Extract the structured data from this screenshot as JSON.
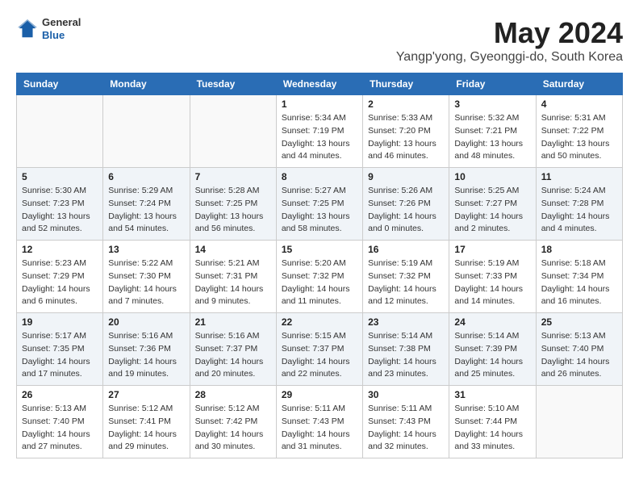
{
  "header": {
    "logo": {
      "general": "General",
      "blue": "Blue"
    },
    "month_year": "May 2024",
    "location": "Yangp'yong, Gyeonggi-do, South Korea"
  },
  "weekdays": [
    "Sunday",
    "Monday",
    "Tuesday",
    "Wednesday",
    "Thursday",
    "Friday",
    "Saturday"
  ],
  "weeks": [
    [
      {
        "day": "",
        "info": ""
      },
      {
        "day": "",
        "info": ""
      },
      {
        "day": "",
        "info": ""
      },
      {
        "day": "1",
        "info": "Sunrise: 5:34 AM\nSunset: 7:19 PM\nDaylight: 13 hours\nand 44 minutes."
      },
      {
        "day": "2",
        "info": "Sunrise: 5:33 AM\nSunset: 7:20 PM\nDaylight: 13 hours\nand 46 minutes."
      },
      {
        "day": "3",
        "info": "Sunrise: 5:32 AM\nSunset: 7:21 PM\nDaylight: 13 hours\nand 48 minutes."
      },
      {
        "day": "4",
        "info": "Sunrise: 5:31 AM\nSunset: 7:22 PM\nDaylight: 13 hours\nand 50 minutes."
      }
    ],
    [
      {
        "day": "5",
        "info": "Sunrise: 5:30 AM\nSunset: 7:23 PM\nDaylight: 13 hours\nand 52 minutes."
      },
      {
        "day": "6",
        "info": "Sunrise: 5:29 AM\nSunset: 7:24 PM\nDaylight: 13 hours\nand 54 minutes."
      },
      {
        "day": "7",
        "info": "Sunrise: 5:28 AM\nSunset: 7:25 PM\nDaylight: 13 hours\nand 56 minutes."
      },
      {
        "day": "8",
        "info": "Sunrise: 5:27 AM\nSunset: 7:25 PM\nDaylight: 13 hours\nand 58 minutes."
      },
      {
        "day": "9",
        "info": "Sunrise: 5:26 AM\nSunset: 7:26 PM\nDaylight: 14 hours\nand 0 minutes."
      },
      {
        "day": "10",
        "info": "Sunrise: 5:25 AM\nSunset: 7:27 PM\nDaylight: 14 hours\nand 2 minutes."
      },
      {
        "day": "11",
        "info": "Sunrise: 5:24 AM\nSunset: 7:28 PM\nDaylight: 14 hours\nand 4 minutes."
      }
    ],
    [
      {
        "day": "12",
        "info": "Sunrise: 5:23 AM\nSunset: 7:29 PM\nDaylight: 14 hours\nand 6 minutes."
      },
      {
        "day": "13",
        "info": "Sunrise: 5:22 AM\nSunset: 7:30 PM\nDaylight: 14 hours\nand 7 minutes."
      },
      {
        "day": "14",
        "info": "Sunrise: 5:21 AM\nSunset: 7:31 PM\nDaylight: 14 hours\nand 9 minutes."
      },
      {
        "day": "15",
        "info": "Sunrise: 5:20 AM\nSunset: 7:32 PM\nDaylight: 14 hours\nand 11 minutes."
      },
      {
        "day": "16",
        "info": "Sunrise: 5:19 AM\nSunset: 7:32 PM\nDaylight: 14 hours\nand 12 minutes."
      },
      {
        "day": "17",
        "info": "Sunrise: 5:19 AM\nSunset: 7:33 PM\nDaylight: 14 hours\nand 14 minutes."
      },
      {
        "day": "18",
        "info": "Sunrise: 5:18 AM\nSunset: 7:34 PM\nDaylight: 14 hours\nand 16 minutes."
      }
    ],
    [
      {
        "day": "19",
        "info": "Sunrise: 5:17 AM\nSunset: 7:35 PM\nDaylight: 14 hours\nand 17 minutes."
      },
      {
        "day": "20",
        "info": "Sunrise: 5:16 AM\nSunset: 7:36 PM\nDaylight: 14 hours\nand 19 minutes."
      },
      {
        "day": "21",
        "info": "Sunrise: 5:16 AM\nSunset: 7:37 PM\nDaylight: 14 hours\nand 20 minutes."
      },
      {
        "day": "22",
        "info": "Sunrise: 5:15 AM\nSunset: 7:37 PM\nDaylight: 14 hours\nand 22 minutes."
      },
      {
        "day": "23",
        "info": "Sunrise: 5:14 AM\nSunset: 7:38 PM\nDaylight: 14 hours\nand 23 minutes."
      },
      {
        "day": "24",
        "info": "Sunrise: 5:14 AM\nSunset: 7:39 PM\nDaylight: 14 hours\nand 25 minutes."
      },
      {
        "day": "25",
        "info": "Sunrise: 5:13 AM\nSunset: 7:40 PM\nDaylight: 14 hours\nand 26 minutes."
      }
    ],
    [
      {
        "day": "26",
        "info": "Sunrise: 5:13 AM\nSunset: 7:40 PM\nDaylight: 14 hours\nand 27 minutes."
      },
      {
        "day": "27",
        "info": "Sunrise: 5:12 AM\nSunset: 7:41 PM\nDaylight: 14 hours\nand 29 minutes."
      },
      {
        "day": "28",
        "info": "Sunrise: 5:12 AM\nSunset: 7:42 PM\nDaylight: 14 hours\nand 30 minutes."
      },
      {
        "day": "29",
        "info": "Sunrise: 5:11 AM\nSunset: 7:43 PM\nDaylight: 14 hours\nand 31 minutes."
      },
      {
        "day": "30",
        "info": "Sunrise: 5:11 AM\nSunset: 7:43 PM\nDaylight: 14 hours\nand 32 minutes."
      },
      {
        "day": "31",
        "info": "Sunrise: 5:10 AM\nSunset: 7:44 PM\nDaylight: 14 hours\nand 33 minutes."
      },
      {
        "day": "",
        "info": ""
      }
    ]
  ]
}
